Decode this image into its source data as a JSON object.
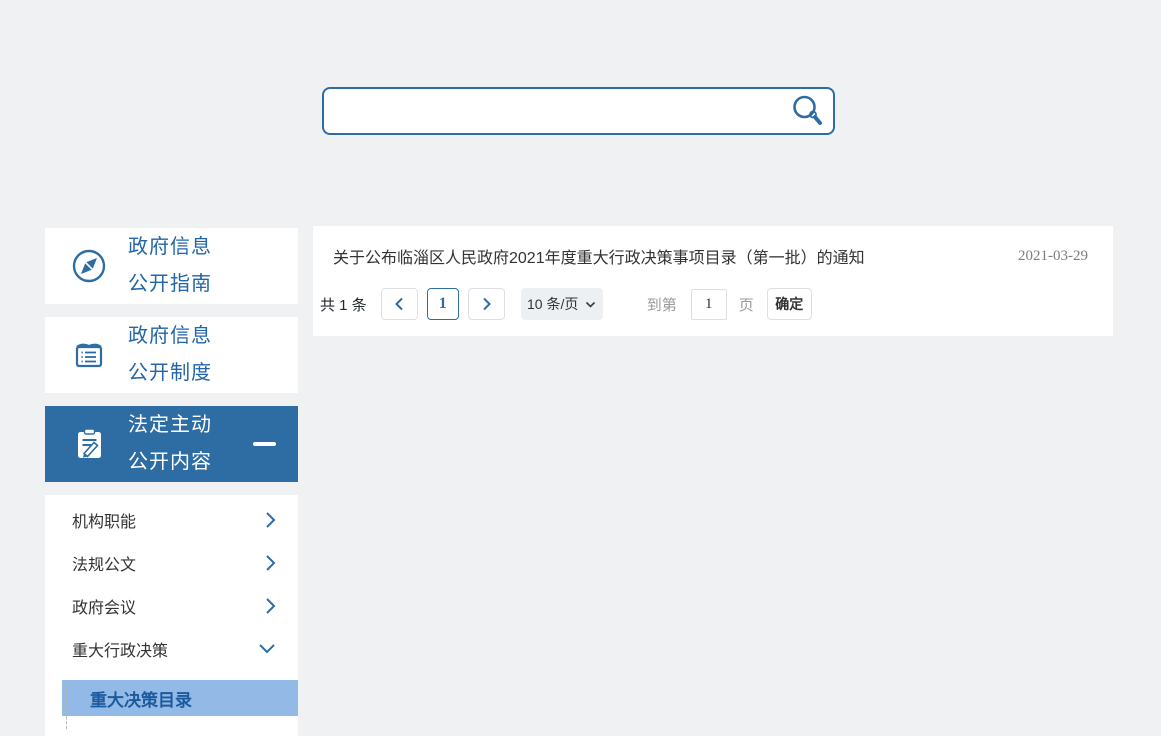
{
  "colors": {
    "accent": "#2e6da4",
    "active_item_bg": "#2e6da4",
    "highlight_bg": "#93b9e6",
    "highlight_text": "#1c5a9e",
    "sidebar_text": "#2265a8",
    "body_text": "#333333",
    "muted_text": "#9a9a9a",
    "date_text": "#7d7d7d",
    "page_bg": "#f0f1f2"
  },
  "search": {
    "value": "",
    "placeholder": "",
    "icon": "search-icon"
  },
  "sidebar": {
    "cards": [
      {
        "icon": "compass-icon",
        "line1": "政府信息",
        "line2": "公开指南",
        "active": false
      },
      {
        "icon": "document-icon",
        "line1": "政府信息",
        "line2": "公开制度",
        "active": false
      },
      {
        "icon": "clipboard-pen-icon",
        "line1": "法定主动",
        "line2": "公开内容",
        "active": true,
        "collapse_icon": "minus-icon"
      }
    ],
    "submenu": [
      {
        "label": "机构职能",
        "icon": "chevron-right-icon"
      },
      {
        "label": "法规公文",
        "icon": "chevron-right-icon"
      },
      {
        "label": "政府会议",
        "icon": "chevron-right-icon"
      },
      {
        "label": "重大行政决策",
        "icon": "chevron-down-icon"
      }
    ],
    "submenu_children": [
      {
        "label": "重大决策目录",
        "selected": true
      }
    ]
  },
  "content": {
    "articles": [
      {
        "title": "关于公布临淄区人民政府2021年度重大行政决策事项目录（第一批）的通知",
        "date": "2021-03-29"
      }
    ],
    "pagination": {
      "total": "共 1 条",
      "current_page": "1",
      "page_size": "10 条/页",
      "goto_label": "到第",
      "goto_value": "1",
      "goto_unit": "页",
      "confirm": "确定"
    }
  }
}
